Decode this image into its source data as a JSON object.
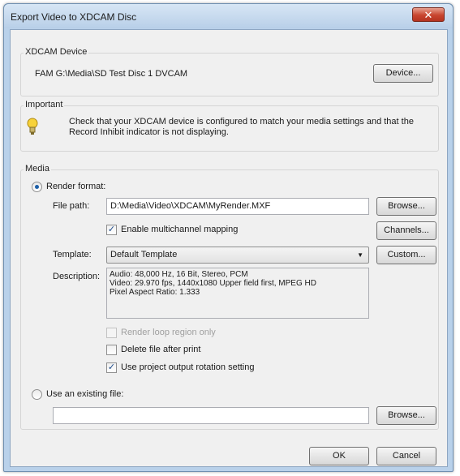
{
  "window": {
    "title": "Export Video to XDCAM Disc",
    "close_glyph": "✕"
  },
  "device_group": {
    "label": "XDCAM Device",
    "device_path": "FAM G:\\Media\\SD Test Disc 1 DVCAM",
    "device_button": "Device..."
  },
  "important_group": {
    "label": "Important",
    "icon": "lightbulb-icon",
    "message_line1": "Check that your XDCAM device is configured to match your media settings and that the",
    "message_line2": "Record Inhibit indicator is not displaying."
  },
  "media_group": {
    "label": "Media",
    "render_format": {
      "label": "Render format:",
      "checked": true
    },
    "file_path": {
      "label": "File path:",
      "value": "D:\\Media\\Video\\XDCAM\\MyRender.MXF",
      "browse_button": "Browse..."
    },
    "multichannel": {
      "label": "Enable multichannel mapping",
      "checked": true,
      "check_glyph": "✓"
    },
    "channels_button": "Channels...",
    "template": {
      "label": "Template:",
      "selected": "Default Template",
      "arrow_glyph": "▼",
      "custom_button": "Custom..."
    },
    "description": {
      "label": "Description:",
      "lines": [
        "Audio: 48,000 Hz, 16 Bit, Stereo, PCM",
        "Video: 29.970 fps, 1440x1080 Upper field first, MPEG HD",
        "Pixel Aspect Ratio: 1.333"
      ]
    },
    "render_loop": {
      "label": "Render loop region only",
      "checked": false,
      "enabled": false
    },
    "delete_file": {
      "label": "Delete file after print",
      "checked": false
    },
    "use_rotation": {
      "label": "Use project output rotation setting",
      "checked": true,
      "check_glyph": "✓"
    },
    "existing_file": {
      "label": "Use an existing file:",
      "checked": false,
      "value": "",
      "browse_button": "Browse..."
    }
  },
  "footer": {
    "ok_button": "OK",
    "cancel_button": "Cancel"
  },
  "colors": {
    "title_bar": "#b9d1ea",
    "close_button": "#c8452f",
    "dialog_background": "#f0f0f0",
    "check_mark": "#1c4a8a"
  }
}
